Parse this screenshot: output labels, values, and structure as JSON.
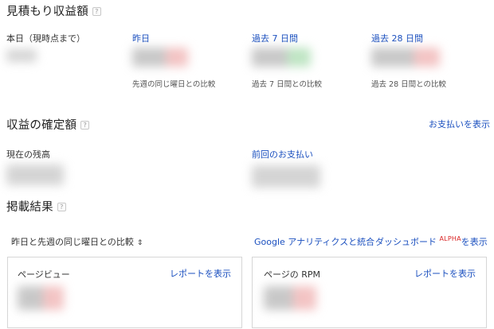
{
  "estimate": {
    "title": "見積もり収益額",
    "help_icon": "?",
    "today_label": "本日（現時点まで）",
    "yesterday_link": "昨日",
    "last7_link": "過去 7 日間",
    "last28_link": "過去 28 日間",
    "yesterday_compare": "先週の同じ曜日との比較",
    "last7_compare": "過去 7 日間との比較",
    "last28_compare": "過去 28 日間との比較"
  },
  "finalized": {
    "title": "収益の確定額",
    "help_icon": "?",
    "view_payments": "お支払いを表示",
    "balance_label": "現在の残高",
    "last_payment_link": "前回のお支払い"
  },
  "performance": {
    "title": "掲載結果",
    "help_icon": "?",
    "compare_select": "昨日と先週の同じ曜日との比較",
    "select_arrow": "⇕",
    "analytics_link": "Google アナリティクスと統合",
    "dashboard_prefix": "ダッシュボード",
    "alpha_badge": "ALPHA",
    "dashboard_suffix": "を表示",
    "cards": [
      {
        "title": "ページビュー",
        "link": "レポートを表示"
      },
      {
        "title": "ページの RPM",
        "link": "レポートを表示"
      }
    ]
  }
}
